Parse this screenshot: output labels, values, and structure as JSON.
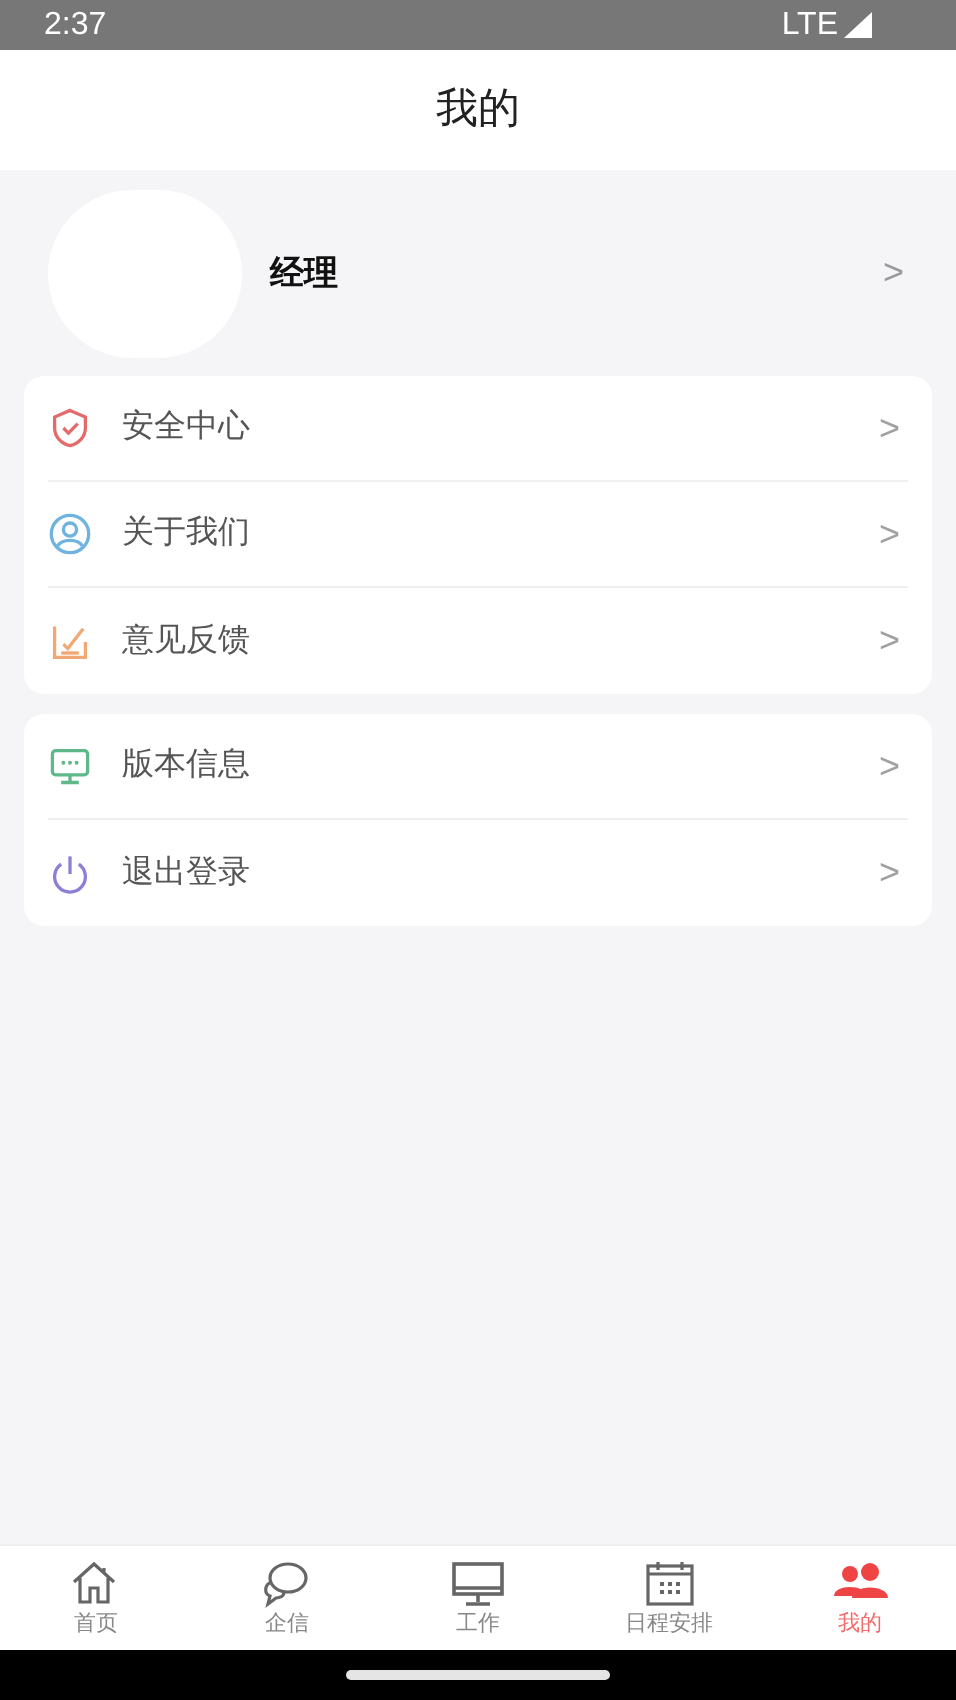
{
  "status_bar": {
    "time": "2:37",
    "network": "LTE"
  },
  "header": {
    "title": "我的"
  },
  "profile": {
    "name": "经理",
    "chevron": ">"
  },
  "menu_groups": [
    {
      "items": [
        {
          "kind": "shield",
          "label": "安全中心",
          "chevron": ">"
        },
        {
          "kind": "person",
          "label": "关于我们",
          "chevron": ">"
        },
        {
          "kind": "feedback",
          "label": "意见反馈",
          "chevron": ">"
        }
      ]
    },
    {
      "items": [
        {
          "kind": "monitor",
          "label": "版本信息",
          "chevron": ">"
        },
        {
          "kind": "power",
          "label": "退出登录",
          "chevron": ">"
        }
      ]
    }
  ],
  "tab_bar": [
    {
      "kind": "home",
      "label": "首页",
      "selected": false
    },
    {
      "kind": "chat",
      "label": "企信",
      "selected": false
    },
    {
      "kind": "desktop",
      "label": "工作",
      "selected": false
    },
    {
      "kind": "calendar",
      "label": "日程安排",
      "selected": false
    },
    {
      "kind": "people",
      "label": "我的",
      "selected": true
    }
  ]
}
